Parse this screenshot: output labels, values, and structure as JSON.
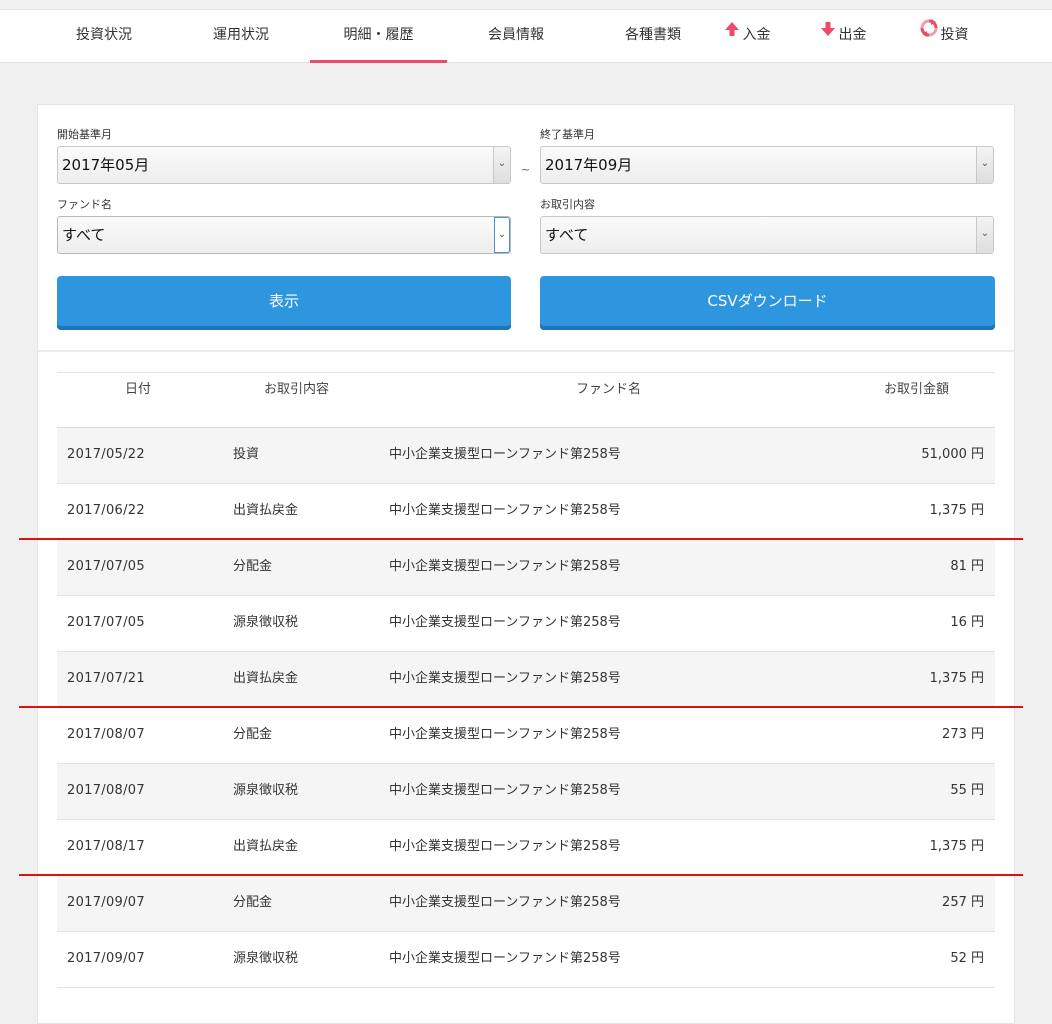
{
  "nav": {
    "items": [
      {
        "label": "投資状況"
      },
      {
        "label": "運用状況"
      },
      {
        "label": "明細・履歴"
      },
      {
        "label": "会員情報"
      },
      {
        "label": "各種書類"
      },
      {
        "label": "入金",
        "icon": "arrow-up-icon"
      },
      {
        "label": "出金",
        "icon": "arrow-down-icon"
      },
      {
        "label": "投資",
        "icon": "refresh-icon"
      }
    ],
    "active_index": 2
  },
  "filters": {
    "start_label": "開始基準月",
    "start_value": "2017年05月",
    "separator": "~",
    "end_label": "終了基準月",
    "end_value": "2017年09月",
    "fund_label": "ファンド名",
    "fund_value": "すべて",
    "type_label": "お取引内容",
    "type_value": "すべて"
  },
  "buttons": {
    "show": "表示",
    "csv": "CSVダウンロード"
  },
  "table": {
    "headers": {
      "date": "日付",
      "type": "お取引内容",
      "fund": "ファンド名",
      "amount": "お取引金額"
    },
    "rows": [
      {
        "date": "2017/05/22",
        "type": "投資",
        "fund": "中小企業支援型ローンファンド第258号",
        "amount": "51,000 円"
      },
      {
        "date": "2017/06/22",
        "type": "出資払戻金",
        "fund": "中小企業支援型ローンファンド第258号",
        "amount": "1,375 円"
      },
      {
        "date": "2017/07/05",
        "type": "分配金",
        "fund": "中小企業支援型ローンファンド第258号",
        "amount": "81 円"
      },
      {
        "date": "2017/07/05",
        "type": "源泉徴収税",
        "fund": "中小企業支援型ローンファンド第258号",
        "amount": "16 円"
      },
      {
        "date": "2017/07/21",
        "type": "出資払戻金",
        "fund": "中小企業支援型ローンファンド第258号",
        "amount": "1,375 円"
      },
      {
        "date": "2017/08/07",
        "type": "分配金",
        "fund": "中小企業支援型ローンファンド第258号",
        "amount": "273 円"
      },
      {
        "date": "2017/08/07",
        "type": "源泉徴収税",
        "fund": "中小企業支援型ローンファンド第258号",
        "amount": "55 円"
      },
      {
        "date": "2017/08/17",
        "type": "出資払戻金",
        "fund": "中小企業支援型ローンファンド第258号",
        "amount": "1,375 円"
      },
      {
        "date": "2017/09/07",
        "type": "分配金",
        "fund": "中小企業支援型ローンファンド第258号",
        "amount": "257 円"
      },
      {
        "date": "2017/09/07",
        "type": "源泉徴収税",
        "fund": "中小企業支援型ローンファンド第258号",
        "amount": "52 円"
      }
    ]
  },
  "colors": {
    "accent": "#ee4a6a",
    "button": "#2d96de",
    "annotation_line": "#e01010"
  }
}
